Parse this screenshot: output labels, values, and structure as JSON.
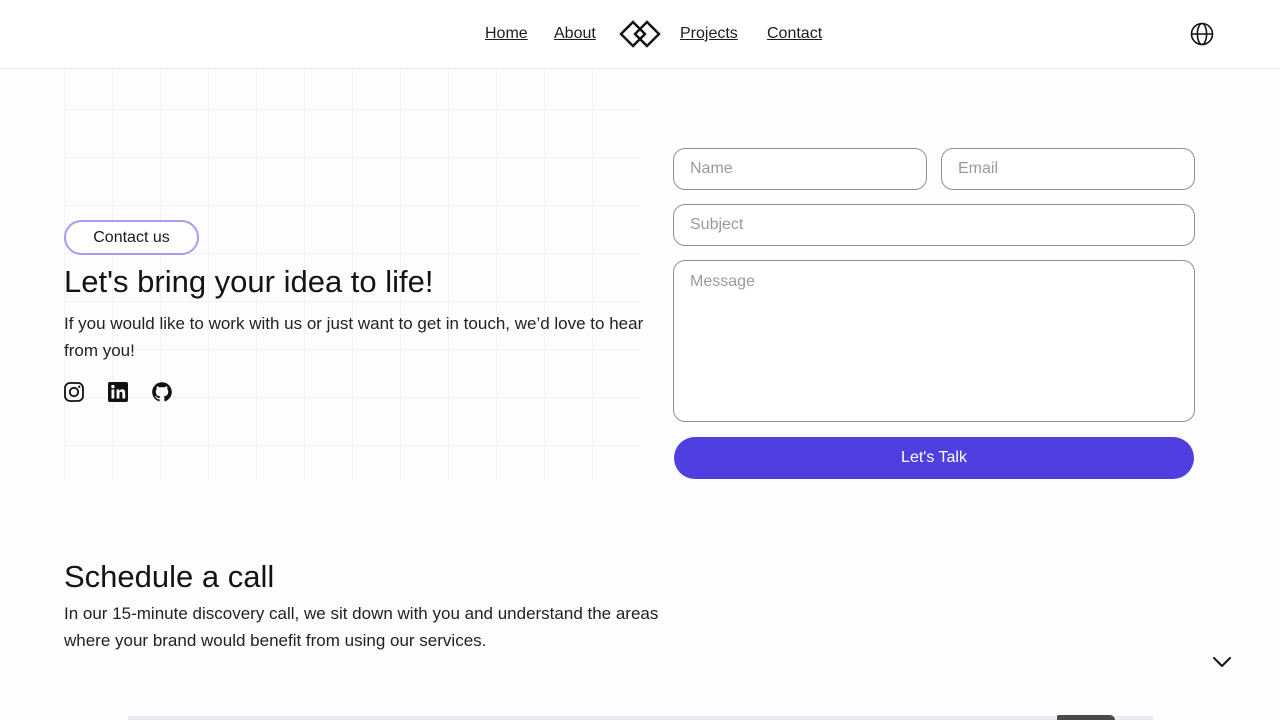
{
  "nav": {
    "home": "Home",
    "about": "About",
    "projects": "Projects",
    "contact": "Contact",
    "logo_icon": "double-diamond-logo",
    "language_icon": "globe-icon"
  },
  "hero": {
    "badge": "Contact us",
    "headline": "Let's bring your idea to life!",
    "intro": "If you would like to work with us or just want to get in touch, we’d love to hear from you!",
    "social_icons": [
      "instagram-icon",
      "linkedin-icon",
      "github-icon"
    ]
  },
  "form": {
    "name_placeholder": "Name",
    "email_placeholder": "Email",
    "subject_placeholder": "Subject",
    "message_placeholder": "Message",
    "submit_label": "Let's Talk"
  },
  "schedule": {
    "title": "Schedule a call",
    "text": "In our 15-minute discovery call, we sit down with you and understand the areas where your brand would benefit from using our services.",
    "expand_icon": "chevron-down-icon"
  },
  "colors": {
    "accent": "#4f3fe0",
    "badge_border": "#a99bf2",
    "background": "#fdfcfe"
  }
}
